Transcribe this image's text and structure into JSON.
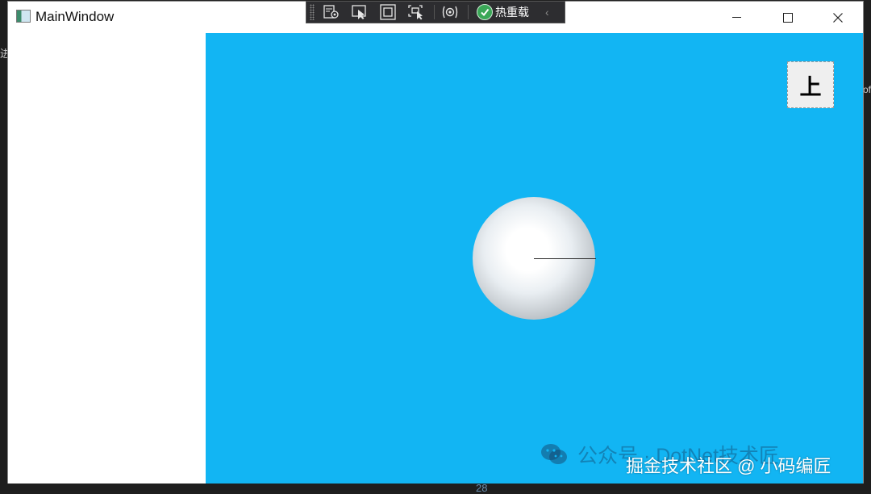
{
  "window": {
    "title": "MainWindow",
    "controls": {
      "minimize": "minimize",
      "maximize": "maximize",
      "close": "close"
    }
  },
  "debug_toolbar": {
    "hot_reload_label": "热重载",
    "icons": [
      "live-visual-tree-icon",
      "select-element-icon",
      "display-adorners-icon",
      "track-focus-icon",
      "hot-reload-options-icon"
    ]
  },
  "viewport": {
    "background": "#12b5f3",
    "up_button_label": "上"
  },
  "edge_text": {
    "left_char": "进",
    "right_char": "of"
  },
  "watermark": {
    "line1": "公众号 · DotNet技术匠",
    "line2": "掘金技术社区 @ 小码编匠"
  },
  "bottom_text": {
    "number": "28"
  }
}
